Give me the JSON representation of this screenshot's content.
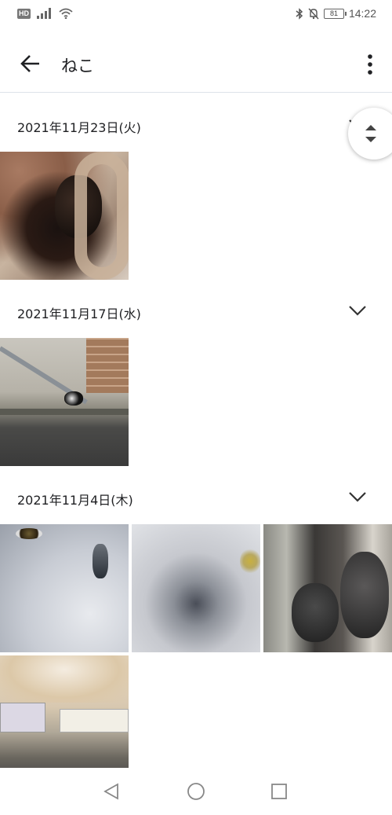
{
  "status_bar": {
    "network_badge": "HD",
    "battery_level": "81",
    "time": "14:22",
    "icons": [
      "signal-icon",
      "wifi-icon",
      "bluetooth-icon",
      "mute-icon",
      "battery-icon"
    ]
  },
  "header": {
    "title": "ねこ",
    "back_icon": "arrow-left-icon",
    "menu_icon": "more-vert-icon"
  },
  "sections": [
    {
      "date": "2021年11月23日(火)",
      "photo_count": 1
    },
    {
      "date": "2021年11月17日(水)",
      "photo_count": 1
    },
    {
      "date": "2021年11月4日(木)",
      "photo_count": 4
    }
  ],
  "nav_bar": {
    "icons": [
      "back-triangle-icon",
      "home-circle-icon",
      "recents-square-icon"
    ]
  },
  "colors": {
    "divider": "#dde3ea",
    "text": "#202124",
    "icon": "#444444"
  }
}
